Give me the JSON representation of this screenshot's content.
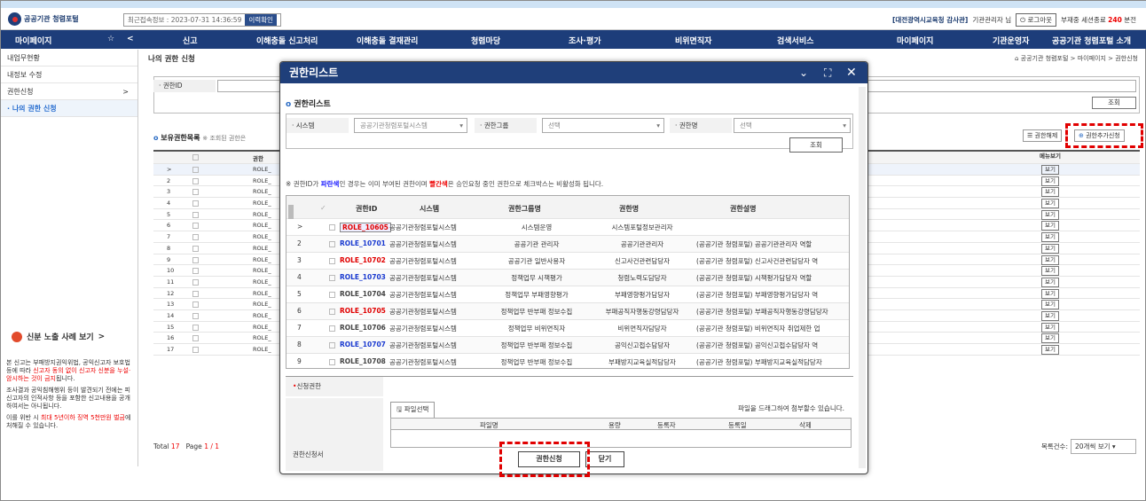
{
  "header": {
    "site_name": "공공기관 청렴포털",
    "last_login": "최근접속정보 : 2023-07-31 14:36:59",
    "history_btn": "이력확인",
    "user_org": "[대전광역시교육청 감사관]",
    "user_role": "기관관리자 님",
    "logout": "로그아웃",
    "session_prefix": "부재중 세션종료",
    "session_num": "240",
    "session_suffix": "분전"
  },
  "nav": {
    "mypage": "마이페이지",
    "items": [
      "신고",
      "이해충돌 신고처리",
      "이해충돌 결재관리",
      "청렴마당",
      "조사·평가",
      "비위면직자",
      "검색서비스",
      "마이페이지",
      "기관운영자",
      "공공기관 청렴포털 소개"
    ]
  },
  "sidebar": {
    "items": [
      "내업무현황",
      "내정보 수정",
      "권한신청",
      "· 나의 권한 신청"
    ],
    "exposure": "신분 노출 사례 보기",
    "exposure_arrow": ">",
    "text1a": "본 신고는 부패방지권익위법, 공익신고자 보호법 등에 따라 ",
    "text1b": "신고자 동의 없이 신고자 신분을 누설·암시하는 것이 금지",
    "text1c": "됩니다.",
    "text2": "조사결과 공익침해행위 등이 발견되기 전에는 피신고자의 인적사항 등을 포함한 신고내용을 공개하여서는 아니됩니다.",
    "text3a": "이를 위반 시 ",
    "text3b": "최대 5년이하 징역 5천만원 벌금",
    "text3c": "에 처해질 수 있습니다."
  },
  "page": {
    "title": "나의 권한 신청",
    "breadcrumb": "공공기관 청렴포털 > 마이페이지 > 권한신청",
    "field_label": "· 권한ID",
    "search_btn": "조회",
    "hold_title": "보유권한목록",
    "hold_note": "※ 조회된 권한은",
    "release_btn": "권한해제",
    "add_btn": "권한추가신청",
    "col_auth": "권한",
    "col_menu": "메뉴보기",
    "rows": [
      "ROLE_",
      "ROLE_",
      "ROLE_",
      "ROLE_",
      "ROLE_",
      "ROLE_",
      "ROLE_",
      "ROLE_",
      "ROLE_",
      "ROLE_",
      "ROLE_",
      "ROLE_",
      "ROLE_",
      "ROLE_",
      "ROLE_",
      "ROLE_",
      "ROLE_"
    ],
    "view": "보기",
    "total_label": "Total",
    "total": "17",
    "page_label": "Page",
    "page": "1 / 1",
    "perpage_label": "목록건수:",
    "perpage": "20개씩 보기"
  },
  "modal": {
    "title": "권한리스트",
    "sub": "권한리스트",
    "f_system": "· 시스템",
    "f_system_val": "공공기관청렴포털시스템",
    "f_group": "· 권한그룹",
    "f_group_val": "선택",
    "f_name": "· 권한명",
    "f_name_val": "선택",
    "search": "조회",
    "note_a": "※ 권한ID가 ",
    "note_b": "파란색",
    "note_c": "인 경우는 이미 부여된 권한이며 ",
    "note_d": "빨간색",
    "note_e": "은 승인요청 중인 권한으로 체크박스는 비활성화 됩니다.",
    "cols": [
      "권한ID",
      "시스템",
      "권한그룹명",
      "권한명",
      "권한설명"
    ],
    "rows": [
      {
        "n": ">",
        "id": "ROLE_10605",
        "color": "#e00000",
        "sys": "공공기관청렴포털시스템",
        "grp": "시스템운영",
        "name": "시스템포털정보관리자",
        "desc": ""
      },
      {
        "n": "2",
        "id": "ROLE_10701",
        "color": "#1a3ad0",
        "sys": "공공기관청렴포털시스템",
        "grp": "공공기관 관리자",
        "name": "공공기관관리자",
        "desc": "(공공기관 청렴포털) 공공기관관리자 역할"
      },
      {
        "n": "3",
        "id": "ROLE_10702",
        "color": "#e00000",
        "sys": "공공기관청렴포털시스템",
        "grp": "공공기관 일반사용자",
        "name": "신고사건관련담당자",
        "desc": "(공공기관 청렴포털) 신고사건관련담당자 역"
      },
      {
        "n": "4",
        "id": "ROLE_10703",
        "color": "#1a3ad0",
        "sys": "공공기관청렴포털시스템",
        "grp": "정책업무 시책평가",
        "name": "청렴노력도담당자",
        "desc": "(공공기관 청렴포털) 시책평가담당자 역할"
      },
      {
        "n": "5",
        "id": "ROLE_10704",
        "color": "#444444",
        "sys": "공공기관청렴포털시스템",
        "grp": "정책업무 부패영향평가",
        "name": "부패영향평가담당자",
        "desc": "(공공기관 청렴포털) 부패영향평가담당자 역"
      },
      {
        "n": "6",
        "id": "ROLE_10705",
        "color": "#e00000",
        "sys": "공공기관청렴포털시스템",
        "grp": "정책업무 반부패 정보수집",
        "name": "부패공직자행동강령담당자",
        "desc": "(공공기관 청렴포털) 부패공직자행동강령담당자"
      },
      {
        "n": "7",
        "id": "ROLE_10706",
        "color": "#444444",
        "sys": "공공기관청렴포털시스템",
        "grp": "정책업무 비위면직자",
        "name": "비위면직자담당자",
        "desc": "(공공기관 청렴포털) 비위면직자 취업제한 업"
      },
      {
        "n": "8",
        "id": "ROLE_10707",
        "color": "#1a3ad0",
        "sys": "공공기관청렴포털시스템",
        "grp": "정책업무 반부패 정보수집",
        "name": "공익신고접수담당자",
        "desc": "(공공기관 청렴포털) 공익신고접수담당자 역"
      },
      {
        "n": "9",
        "id": "ROLE_10708",
        "color": "#444444",
        "sys": "공공기관청렴포털시스템",
        "grp": "정책업무 반부패 정보수집",
        "name": "부패방지교육실적담당자",
        "desc": "(공공기관 청렴포털) 부패방지교육실적담당자"
      }
    ],
    "req_label": "신청권한",
    "doc_label": "권한신청서",
    "file_btn": "파일선택",
    "drag_note": "파일을 드래그하여 첨부할수 있습니다.",
    "fcols": [
      "파일명",
      "용량",
      "등록자",
      "등록일",
      "삭제"
    ],
    "apply": "권한신청",
    "close": "닫기"
  }
}
